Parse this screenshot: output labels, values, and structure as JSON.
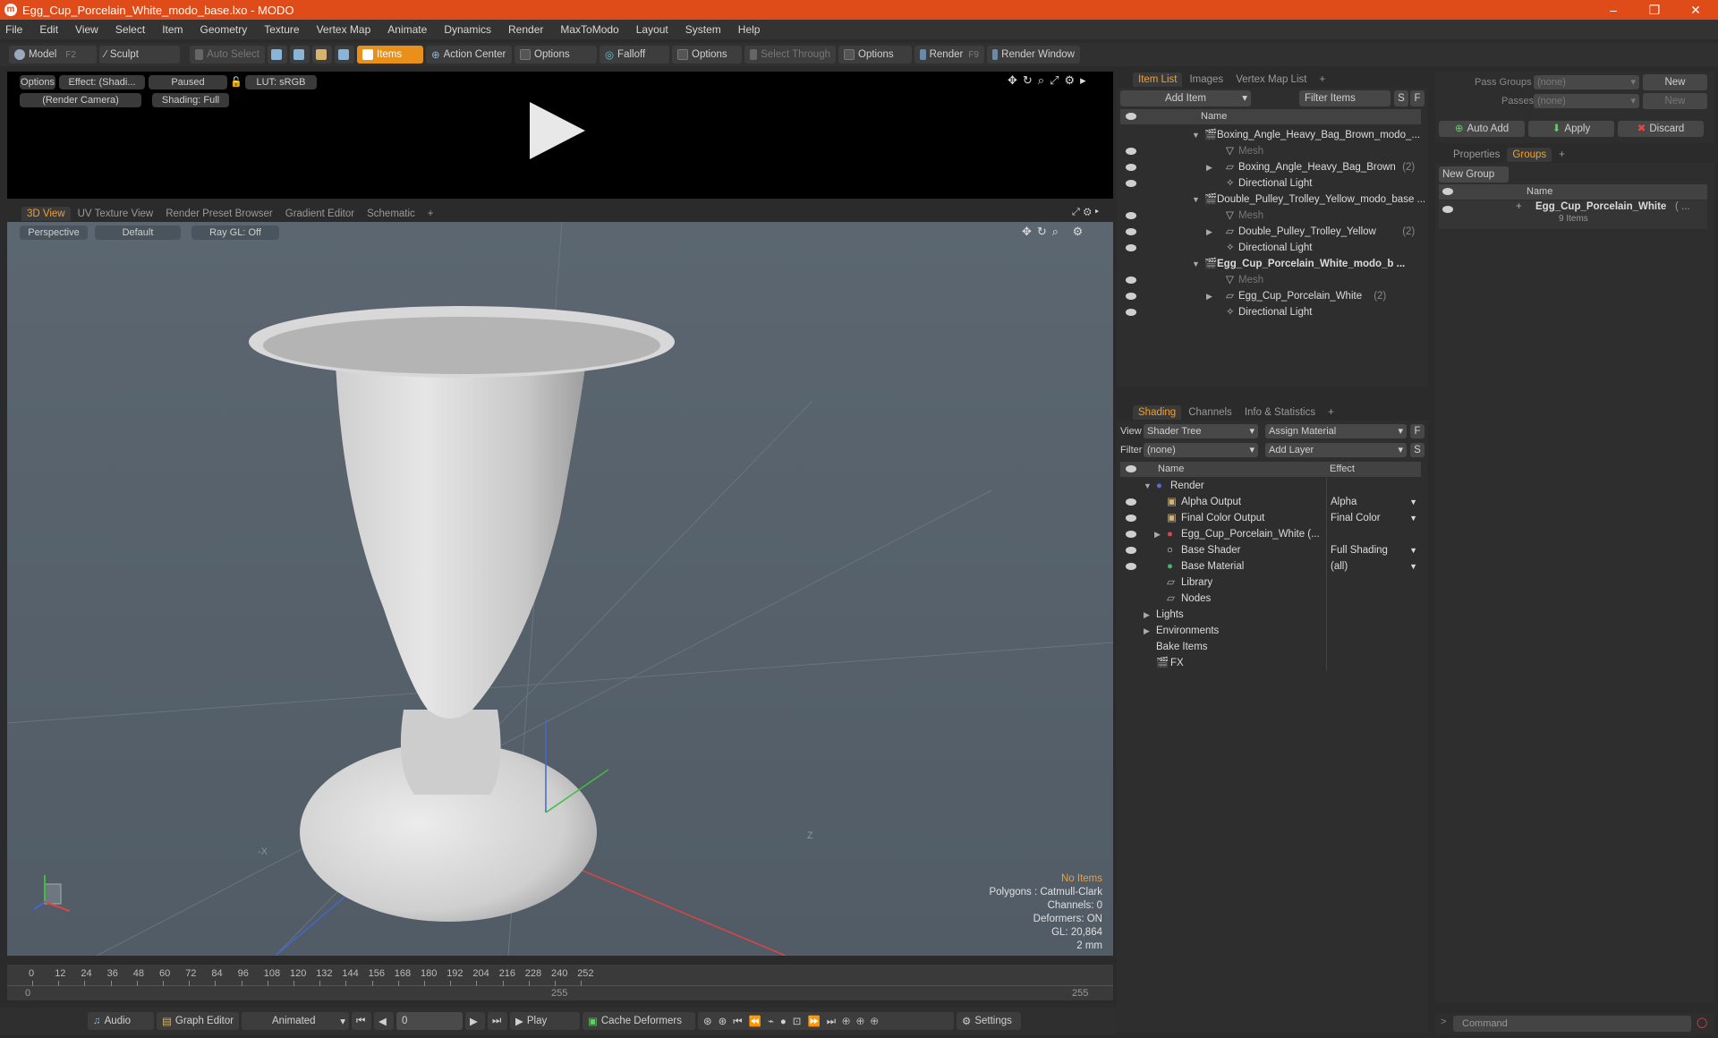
{
  "window": {
    "title": "Egg_Cup_Porcelain_White_modo_base.lxo - MODO",
    "minimize": "–",
    "restore": "❐",
    "close": "✕"
  },
  "menu": [
    "File",
    "Edit",
    "View",
    "Select",
    "Item",
    "Geometry",
    "Texture",
    "Vertex Map",
    "Animate",
    "Dynamics",
    "Render",
    "MaxToModo",
    "Layout",
    "System",
    "Help"
  ],
  "toolbar": {
    "model": "Model",
    "model_key": "F2",
    "sculpt": "Sculpt",
    "auto_select": "Auto Select",
    "items": "Items",
    "action_center": "Action Center",
    "options1": "Options",
    "falloff": "Falloff",
    "options2": "Options",
    "select_through": "Select Through",
    "options3": "Options",
    "render": "Render",
    "render_key": "F9",
    "render_window": "Render Window"
  },
  "preview": {
    "options": "Options",
    "effect": "Effect: (Shadi...",
    "paused": "Paused",
    "lut": "LUT: sRGB",
    "camera": "(Render Camera)",
    "shading": "Shading: Full"
  },
  "viewtabs": [
    "3D View",
    "UV Texture View",
    "Render Preset Browser",
    "Gradient Editor",
    "Schematic",
    "+"
  ],
  "viewport": {
    "perspective": "Perspective",
    "default": "Default",
    "raygl": "Ray GL: Off",
    "axis_x": "-X",
    "axis_z": "Z",
    "info": {
      "no_items": "No Items",
      "polygons": "Polygons : Catmull-Clark",
      "channels": "Channels: 0",
      "deformers": "Deformers: ON",
      "gl": "GL: 20,864",
      "scale": "2 mm"
    }
  },
  "timeline": {
    "ticks": [
      "0",
      "12",
      "24",
      "36",
      "48",
      "60",
      "72",
      "84",
      "96",
      "108",
      "120",
      "132",
      "144",
      "156",
      "168",
      "180",
      "192",
      "204",
      "216",
      "228",
      "240",
      "252"
    ],
    "start": "0",
    "mid": "255",
    "end": "255"
  },
  "bottombar": {
    "audio": "Audio",
    "graph_editor": "Graph Editor",
    "animated": "Animated",
    "frame": "0",
    "play": "Play",
    "cache": "Cache Deformers",
    "settings": "Settings"
  },
  "itemlist": {
    "tabs": [
      "Item List",
      "Images",
      "Vertex Map List",
      "+"
    ],
    "add_item": "Add Item",
    "filter_items": "Filter Items",
    "s": "S",
    "f": "F",
    "name_col": "Name",
    "rows": [
      {
        "label": "Boxing_Angle_Heavy_Bag_Brown_modo_...",
        "indent": 0,
        "type": "scene",
        "bold": false
      },
      {
        "label": "Mesh",
        "indent": 1,
        "type": "mesh",
        "bold": false
      },
      {
        "label": "Boxing_Angle_Heavy_Bag_Brown",
        "count": "(2)",
        "indent": 1,
        "type": "group",
        "bold": false
      },
      {
        "label": "Directional Light",
        "indent": 1,
        "type": "light",
        "bold": false
      },
      {
        "label": "Double_Pulley_Trolley_Yellow_modo_base ...",
        "indent": 0,
        "type": "scene",
        "bold": false
      },
      {
        "label": "Mesh",
        "indent": 1,
        "type": "mesh",
        "bold": false
      },
      {
        "label": "Double_Pulley_Trolley_Yellow",
        "count": "(2)",
        "indent": 1,
        "type": "group",
        "bold": false
      },
      {
        "label": "Directional Light",
        "indent": 1,
        "type": "light",
        "bold": false
      },
      {
        "label": "Egg_Cup_Porcelain_White_modo_b ...",
        "indent": 0,
        "type": "scene",
        "bold": true
      },
      {
        "label": "Mesh",
        "indent": 1,
        "type": "mesh",
        "bold": false
      },
      {
        "label": "Egg_Cup_Porcelain_White",
        "count": "(2)",
        "indent": 1,
        "type": "group",
        "bold": false
      },
      {
        "label": "Directional Light",
        "indent": 1,
        "type": "light",
        "bold": false
      }
    ]
  },
  "shading": {
    "tabs": [
      "Shading",
      "Channels",
      "Info & Statistics",
      "+"
    ],
    "view_label": "View",
    "view_value": "Shader Tree",
    "assign_material": "Assign Material",
    "filter_label": "Filter",
    "filter_value": "(none)",
    "add_layer": "Add Layer",
    "f": "F",
    "s": "S",
    "name_col": "Name",
    "effect_col": "Effect",
    "rows": [
      {
        "label": "Render",
        "effect": "",
        "indent": 0
      },
      {
        "label": "Alpha Output",
        "effect": "Alpha",
        "indent": 1
      },
      {
        "label": "Final Color Output",
        "effect": "Final Color",
        "indent": 1
      },
      {
        "label": "Egg_Cup_Porcelain_White (...",
        "effect": "",
        "indent": 1
      },
      {
        "label": "Base Shader",
        "effect": "Full Shading",
        "indent": 1
      },
      {
        "label": "Base Material",
        "effect": "(all)",
        "indent": 1
      },
      {
        "label": "Library",
        "effect": "",
        "indent": 1
      },
      {
        "label": "Nodes",
        "effect": "",
        "indent": 1
      },
      {
        "label": "Lights",
        "effect": "",
        "indent": 0
      },
      {
        "label": "Environments",
        "effect": "",
        "indent": 0
      },
      {
        "label": "Bake Items",
        "effect": "",
        "indent": 0
      },
      {
        "label": "FX",
        "effect": "",
        "indent": 0
      }
    ]
  },
  "passes": {
    "pass_groups": "Pass Groups",
    "passes": "Passes",
    "none1": "(none)",
    "none2": "(none)",
    "new1": "New",
    "new2": "New"
  },
  "groups": {
    "auto_add": "Auto Add",
    "apply": "Apply",
    "discard": "Discard",
    "tabs": [
      "Properties",
      "Groups",
      "+"
    ],
    "new_group": "New Group",
    "name_col": "Name",
    "item_label": "Egg_Cup_Porcelain_White",
    "item_suffix": "( ...",
    "item_count": "9 Items"
  },
  "command": {
    "placeholder": "Command",
    "prompt": ">"
  },
  "colors": {
    "accent": "#e8901a",
    "title": "#e04b1a"
  }
}
